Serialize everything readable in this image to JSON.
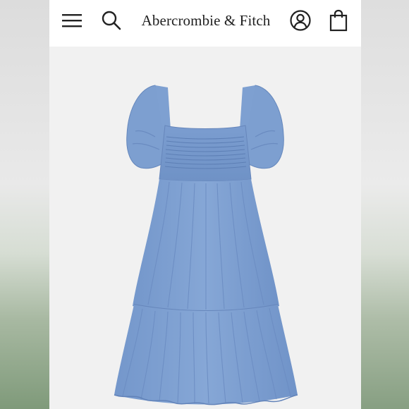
{
  "header": {
    "brand": "Abercrombie & Fitch",
    "icons": {
      "menu": "hamburger-menu-icon",
      "search": "search-icon",
      "account": "user-account-icon",
      "bag": "shopping-bag-icon"
    }
  },
  "product": {
    "image": "blue chambray puff-sleeve square-neck tiered midi dress",
    "colors": {
      "dress": "#7d9fcf",
      "dress_shadow": "#6686bb",
      "background": "#f1f1f1"
    }
  }
}
